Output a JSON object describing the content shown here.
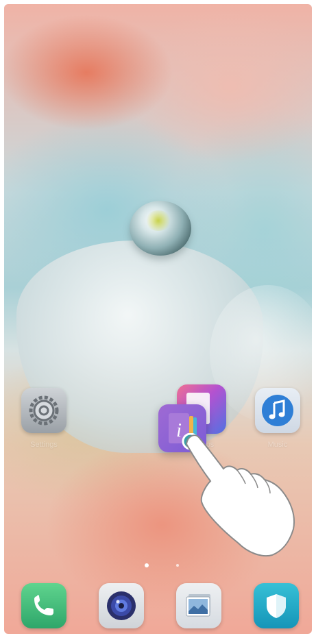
{
  "home_screen": {
    "apps": [
      {
        "label": "Settings",
        "icon": "gear-icon"
      },
      {
        "label": "Tips",
        "icon": "tips-icon"
      },
      {
        "label": "Music",
        "icon": "music-note-icon"
      }
    ],
    "dragged_app": {
      "icon": "info-tips-icon"
    },
    "page_indicator": {
      "current": 1,
      "total": 2
    }
  },
  "dock": {
    "apps": [
      {
        "icon": "phone-icon"
      },
      {
        "icon": "camera-icon"
      },
      {
        "icon": "gallery-icon"
      },
      {
        "icon": "shield-icon"
      }
    ]
  },
  "gesture": {
    "icon": "hand-pointer-icon"
  },
  "colors": {
    "phone_green": "#2ea66a",
    "shield_teal": "#1595b8",
    "tips_purple": "#7b5cd6",
    "music_blue": "#2f7fd6"
  }
}
